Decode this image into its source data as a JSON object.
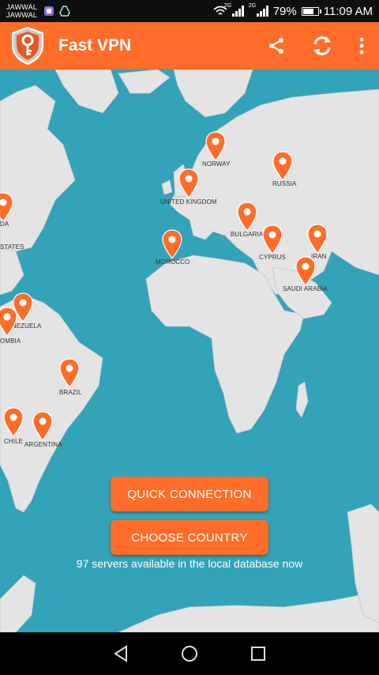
{
  "status_bar": {
    "carrier_1": "JAWWAL",
    "carrier_2": "JAWWAL",
    "network_1": "2G",
    "network_2": "2G",
    "battery_percent": "79%",
    "battery_level": 0.79,
    "time": "11:09 AM"
  },
  "app_bar": {
    "title": "Fast VPN",
    "actions": [
      "share-icon",
      "refresh-icon",
      "more-vert-icon"
    ]
  },
  "map": {
    "countries": [
      {
        "key": "norway",
        "label": "NORWAY"
      },
      {
        "key": "russia",
        "label": "RUSSIA"
      },
      {
        "key": "united_kingdom",
        "label": "UNITED KINGDOM"
      },
      {
        "key": "bulgaria",
        "label": "BULGARIA"
      },
      {
        "key": "cyprus",
        "label": "CYPRUS"
      },
      {
        "key": "iran",
        "label": "IRAN"
      },
      {
        "key": "morocco",
        "label": "MOROCCO"
      },
      {
        "key": "saudi_arabia",
        "label": "SAUDI ARABIA"
      },
      {
        "key": "canada",
        "label": "DA"
      },
      {
        "key": "united_states",
        "label": "STATES"
      },
      {
        "key": "venezuela",
        "label": "VENEZUELA"
      },
      {
        "key": "colombia",
        "label": "OMBIA"
      },
      {
        "key": "brazil",
        "label": "BRAZIL"
      },
      {
        "key": "chile",
        "label": "CHILE"
      },
      {
        "key": "argentina",
        "label": "ARGENTINA"
      }
    ]
  },
  "actions": {
    "quick_connection": "QUICK CONNECTION",
    "choose_country": "CHOOSE COUNTRY",
    "servers_available": "97 servers available in the local database now"
  },
  "colors": {
    "accent": "#ff6d2a",
    "ocean": "#32a3b8",
    "land": "#e4e4e4"
  }
}
